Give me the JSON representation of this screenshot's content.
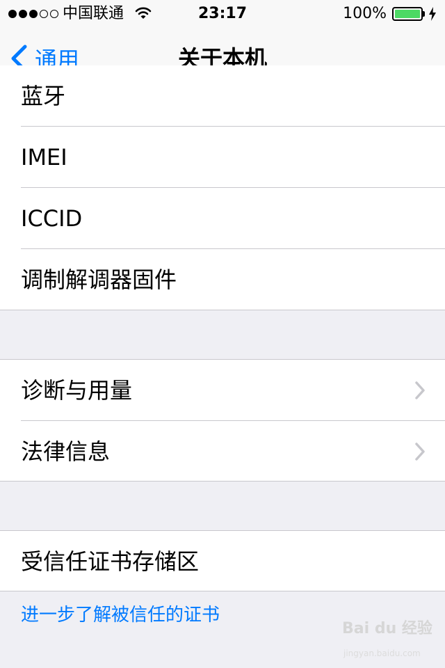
{
  "status_bar": {
    "carrier": "中国联通",
    "time": "23:17",
    "battery": "100%",
    "signal_bars_on": 3,
    "signal_bars_total": 5
  },
  "nav": {
    "back_label": "通用",
    "title": "关于本机"
  },
  "groups": [
    {
      "items": [
        "蓝牙",
        "IMEI",
        "ICCID",
        "调制解调器固件"
      ]
    },
    {
      "items": [
        "诊断与用量",
        "法律信息"
      ]
    },
    {
      "items": [
        "受信任证书存储区"
      ]
    }
  ],
  "footer_link": "进一步了解被信任的证书",
  "watermark": {
    "brand": "Bai du 经验",
    "url": "jingyan.baidu.com"
  },
  "colors": {
    "accent": "#007aff",
    "battery": "#4cd964",
    "background": "#efeff4"
  }
}
